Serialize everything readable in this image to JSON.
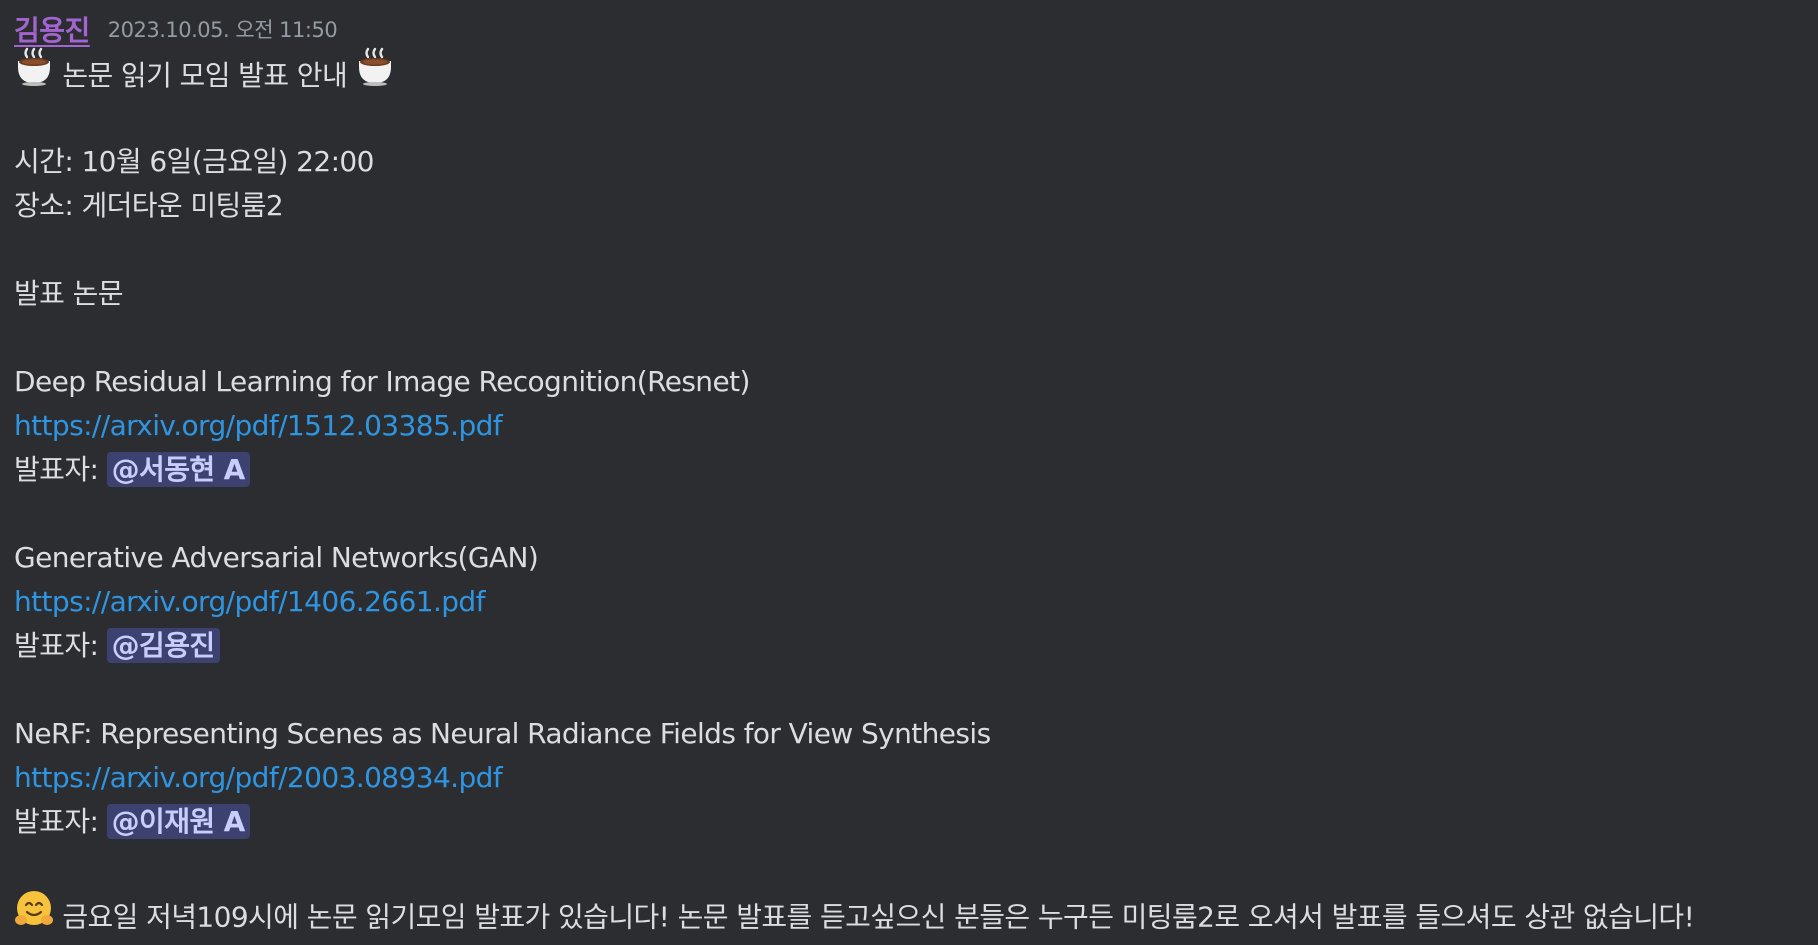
{
  "message": {
    "author": "김용진",
    "timestamp": "2023.10.05. 오전 11:50",
    "title": "논문 읽기 모임 발표 안내",
    "time_line": "시간: 10월 6일(금요일) 22:00",
    "place_line": "장소: 게더타운 미팅룸2",
    "section_heading": "발표 논문",
    "presenter_label": "발표자:",
    "papers": [
      {
        "title": "Deep Residual Learning for Image Recognition(Resnet)",
        "url": "https://arxiv.org/pdf/1512.03385.pdf",
        "presenter": "@서동현 A"
      },
      {
        "title": "Generative Adversarial Networks(GAN)",
        "url": "https://arxiv.org/pdf/1406.2661.pdf",
        "presenter": "@김용진"
      },
      {
        "title": "NeRF: Representing Scenes as Neural Radiance Fields for View Synthesis",
        "url": "https://arxiv.org/pdf/2003.08934.pdf",
        "presenter": "@이재원 A"
      }
    ],
    "closing": "금요일 저녁109시에 논문 읽기모임 발표가 있습니다! 논문 발표를 듣고싶으신 분들은 누구든 미팅룸2로 오셔서 발표를 들으셔도 상관 없습니다!"
  },
  "icons": {
    "title_emoji": "coffee-cup-icon",
    "closing_emoji": "hugging-face-icon"
  },
  "colors": {
    "background": "#2b2d31",
    "text": "#dbdee1",
    "author": "#a265d0",
    "timestamp": "#949ba4",
    "link": "#2f95e0",
    "mention_bg": "#3c4170",
    "mention_text": "#c9cdfb"
  }
}
